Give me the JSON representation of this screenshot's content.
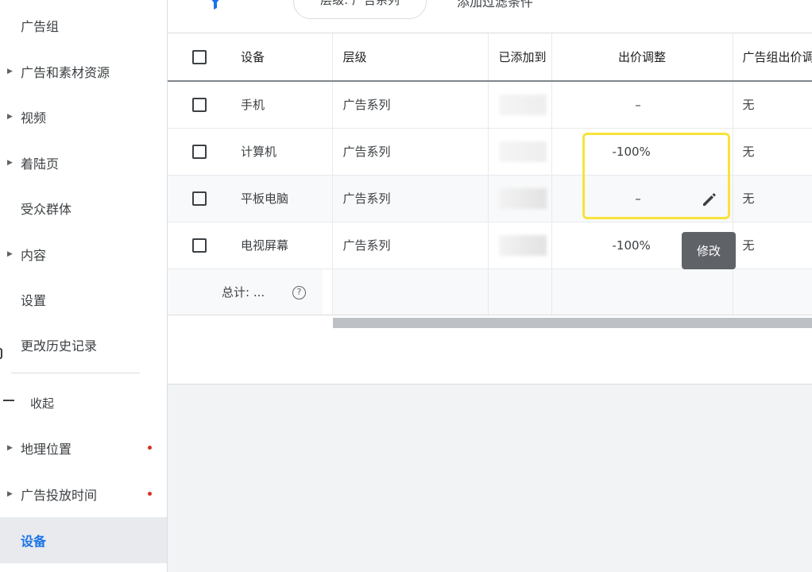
{
  "sidebar": {
    "items": [
      {
        "label": "广告组",
        "arrow": false,
        "dot": false
      },
      {
        "label": "广告和素材资源",
        "arrow": true,
        "dot": false
      },
      {
        "label": "视频",
        "arrow": true,
        "dot": false
      },
      {
        "label": "着陆页",
        "arrow": true,
        "dot": false
      },
      {
        "label": "受众群体",
        "arrow": false,
        "dot": false
      },
      {
        "label": "内容",
        "arrow": true,
        "dot": false
      },
      {
        "label": "设置",
        "arrow": false,
        "dot": false
      },
      {
        "label": "更改历史记录",
        "arrow": false,
        "dot": false
      }
    ],
    "collapse_label": "收起",
    "lower_items": [
      {
        "label": "地理位置",
        "arrow": true,
        "dot": true
      },
      {
        "label": "广告投放时间",
        "arrow": true,
        "dot": true
      },
      {
        "label": "设备",
        "arrow": false,
        "dot": false,
        "active": true
      }
    ]
  },
  "filterbar": {
    "chip_label": "层级: 广告系列",
    "add_filter_label": "添加过滤条件"
  },
  "table": {
    "headers": {
      "device": "设备",
      "level": "层级",
      "added": "已添加到",
      "bid_adjust": "出价调整",
      "group_bid": "广告组出价调整"
    },
    "rows": [
      {
        "device": "手机",
        "level": "广告系列",
        "bid": "–",
        "group_bid": "无"
      },
      {
        "device": "计算机",
        "level": "广告系列",
        "bid": "-100%",
        "group_bid": "无"
      },
      {
        "device": "平板电脑",
        "level": "广告系列",
        "bid": "–",
        "group_bid": "无"
      },
      {
        "device": "电视屏幕",
        "level": "广告系列",
        "bid": "-100%",
        "group_bid": "无"
      }
    ],
    "total_label": "总计: ...",
    "help_glyph": "?"
  },
  "tooltip": {
    "label": "修改"
  },
  "colors": {
    "accent": "#1a73e8",
    "highlight": "#f7e33a",
    "alert_dot": "#d93025"
  }
}
